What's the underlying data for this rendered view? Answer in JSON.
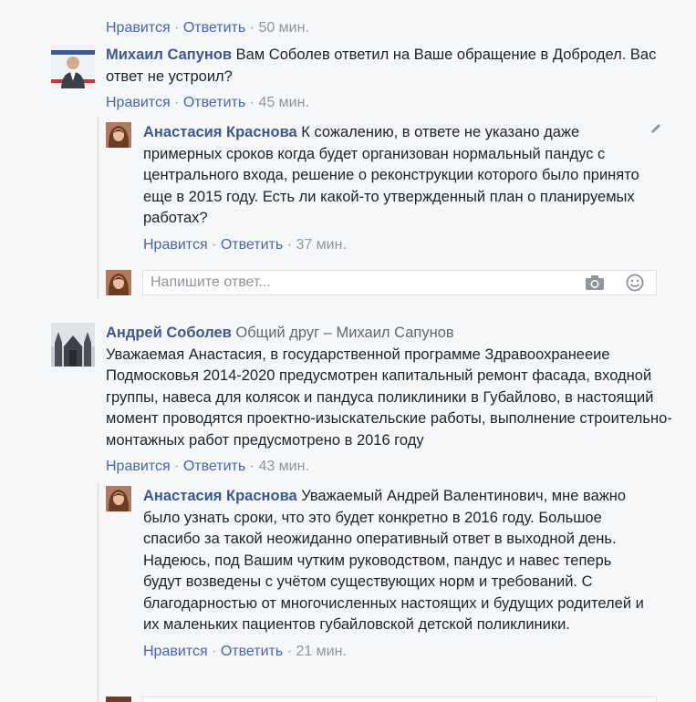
{
  "top_row": {
    "like": "Нравится",
    "reply": "Ответить",
    "sep": " · ",
    "time": "50 мин."
  },
  "comments": [
    {
      "author": "Михаил Сапунов",
      "text": "Вам Соболев ответил на Ваше обращение в Добродел. Вас ответ не устроил?",
      "like": "Нравится",
      "reply": "Ответить",
      "time": "45 мин."
    },
    {
      "author": "Андрей Соболев",
      "mutual": "Общий друг – Михаил Сапунов",
      "text": "Уважаемая Анастасия, в государственной программе Здравоохранееие Подмосковья 2014-2020 предусмотрен капитальный ремонт фасада, входной группы, навеса для колясок и пандуса поликлиники в Губайлово, в настоящий момент проводятся проектно-изыскательские работы, выполнение строительно-монтажных работ предусмотрено в 2016 году",
      "like": "Нравится",
      "reply": "Ответить",
      "time": "43 мин."
    }
  ],
  "replies": [
    {
      "author": "Анастасия Краснова",
      "text": "К сожалению, в ответе не указано даже примерных сроков когда будет организован нормальный пандус с центрального входа, решение о реконструкции которого было принято еще в 2015 году. Есть ли какой-то утвержденный план о планируемых работах?",
      "like": "Нравится",
      "reply": "Ответить",
      "time": "37 мин."
    },
    {
      "author": "Анастасия Краснова",
      "text": "Уважаемый Андрей Валентинович, мне важно было узнать сроки, что это будет конкретно в 2016 году. Большое спасибо за такой неожиданно оперативный ответ в выходной день. Надеюсь, под Вашим чутким руководством, пандус и навес теперь будут возведены с учётом существующих норм и требований. С благодарностью от многочисленных настоящих и будущих родителей и их маленьких пациентов губайловской детской поликлиники.",
      "like": "Нравится",
      "reply": "Ответить",
      "time": "21 мин."
    }
  ],
  "reply_box": {
    "placeholder": "Напишите ответ...",
    "camera_icon": "camera-icon",
    "emoji_icon": "smiley-icon"
  },
  "icons": {
    "edit": "pencil-icon"
  },
  "colors": {
    "background": "#f6f7f9",
    "author": "#385898",
    "link": "#4267b2",
    "meta": "#90949c"
  }
}
